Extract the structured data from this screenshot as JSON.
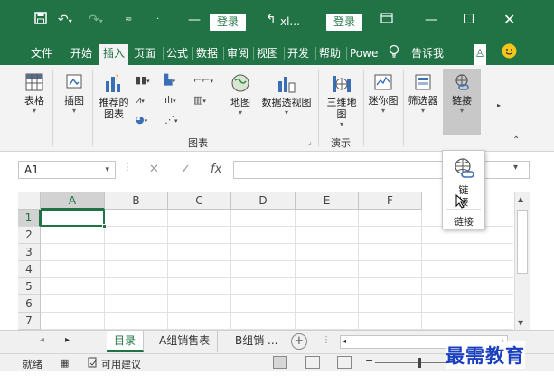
{
  "titlebar": {
    "login_label_1": "登录",
    "file_name_short": "xl...",
    "login_label_2": "登录",
    "colors": {
      "accent": "#217346"
    }
  },
  "menu": {
    "items": [
      "文件",
      "开始",
      "插入",
      "页面",
      "公式",
      "数据",
      "审阅",
      "视图",
      "开发",
      "帮助",
      "Powe",
      "告诉我"
    ]
  },
  "ribbon": {
    "buttons": {
      "table": "表格",
      "illustration": "插图",
      "recommended_charts": "推荐的\n图表",
      "map": "地图",
      "pivot_chart": "数据透视图",
      "map3d": "三维地\n图",
      "sparklines": "迷你图",
      "filters": "筛选器",
      "link": "链接"
    },
    "groups": {
      "charts": "图表",
      "tours": "演示"
    }
  },
  "formula_bar": {
    "name_box": "A1",
    "fx_label": "fx"
  },
  "grid": {
    "columns": [
      "A",
      "B",
      "C",
      "D",
      "E",
      "F"
    ],
    "rows": [
      "1",
      "2",
      "3",
      "4",
      "5",
      "6",
      "7"
    ],
    "selected_cell": "A1"
  },
  "popup": {
    "label_line1": "链",
    "label_line2": "接",
    "tooltip": "链接"
  },
  "sheets": {
    "tabs": [
      "目录",
      "A组销售表",
      "B组销 ..."
    ],
    "active_index": 0
  },
  "statusbar": {
    "ready": "就绪",
    "accessibility": "可用建议"
  },
  "watermark": "最需教育"
}
